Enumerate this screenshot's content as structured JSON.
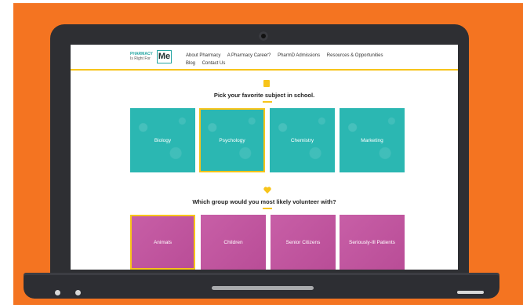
{
  "nav": {
    "logo_line1": "PHARMACY",
    "logo_line2": "Is Right For",
    "logo_badge": "Me",
    "links": [
      "About Pharmacy",
      "A Pharmacy Career?",
      "PharmD Admissions",
      "Resources & Opportunities",
      "Blog",
      "Contact Us"
    ]
  },
  "question1": {
    "title": "Pick your favorite subject in school.",
    "icon": "book-icon",
    "options": [
      "Biology",
      "Psychology",
      "Chemistry",
      "Marketing"
    ],
    "selected": "Psychology"
  },
  "question2": {
    "title": "Which group would you most likely volunteer with?",
    "icon": "heart-icon",
    "options": [
      "Animals",
      "Children",
      "Senior Citizens",
      "Seriously-Ill Patients"
    ],
    "selected": "Animals"
  },
  "colors": {
    "background": "#f47421",
    "accent": "#f7c41a",
    "teal_tile": "#2bb7b2",
    "pink_tile": "#c3519f",
    "laptop": "#2e2f33"
  }
}
